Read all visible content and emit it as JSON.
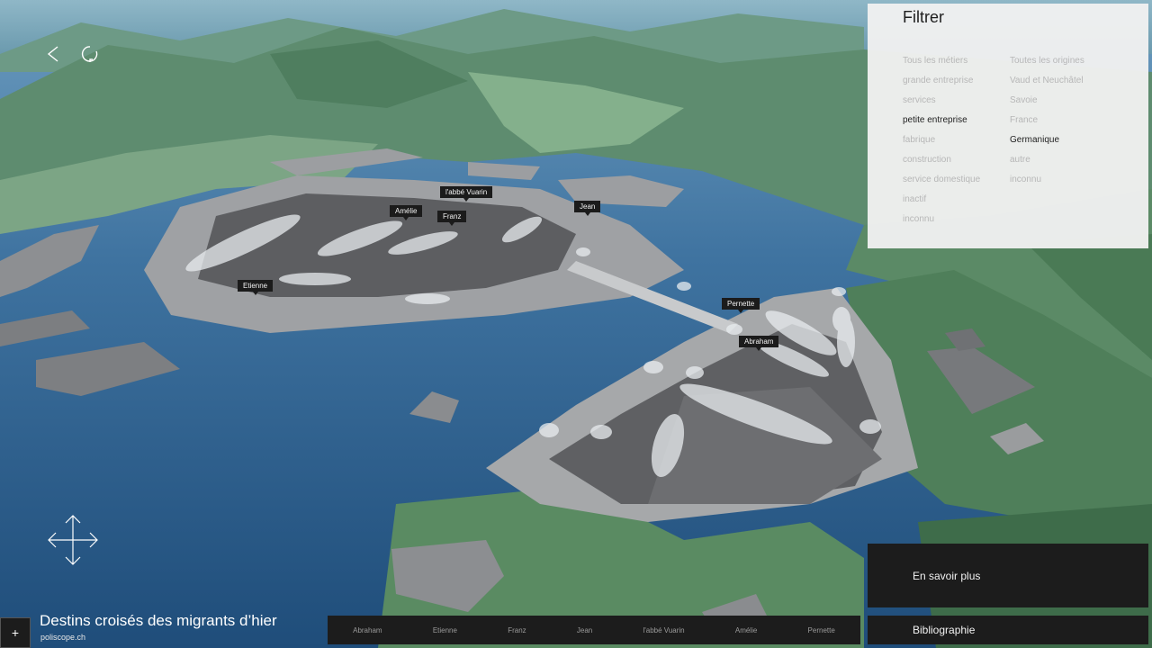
{
  "app": {
    "title": "Destins croisés des migrants d’hier",
    "site": "poliscope.ch",
    "plus_label": "+"
  },
  "controls": {
    "back_icon": "chevron-left-icon",
    "reload_icon": "rotate-icon",
    "pan_icon": "four-way-arrows-icon"
  },
  "map_pins": [
    {
      "label": "l'abbé Vuarin"
    },
    {
      "label": "Amélie"
    },
    {
      "label": "Franz"
    },
    {
      "label": "Jean"
    },
    {
      "label": "Etienne"
    },
    {
      "label": "Pernette"
    },
    {
      "label": "Abraham"
    }
  ],
  "filter": {
    "title": "Filtrer",
    "professions": [
      {
        "label": "Tous les métiers",
        "active": false
      },
      {
        "label": "grande entreprise",
        "active": false
      },
      {
        "label": "services",
        "active": false
      },
      {
        "label": "petite entreprise",
        "active": true
      },
      {
        "label": "fabrique",
        "active": false
      },
      {
        "label": "construction",
        "active": false
      },
      {
        "label": "service domestique",
        "active": false
      },
      {
        "label": "inactif",
        "active": false
      },
      {
        "label": "inconnu",
        "active": false
      }
    ],
    "origins": [
      {
        "label": "Toutes les origines",
        "active": false
      },
      {
        "label": "Vaud et Neuchâtel",
        "active": false
      },
      {
        "label": "Savoie",
        "active": false
      },
      {
        "label": "France",
        "active": false
      },
      {
        "label": "Germanique",
        "active": true
      },
      {
        "label": "autre",
        "active": false
      },
      {
        "label": "inconnu",
        "active": false
      }
    ]
  },
  "characters": [
    "Abraham",
    "Etienne",
    "Franz",
    "Jean",
    "l'abbé Vuarin",
    "Amélie",
    "Pernette"
  ],
  "buttons": {
    "learn_more": "En savoir plus",
    "bibliography": "Bibliographie"
  },
  "colors": {
    "lake": "#2c5677",
    "land": "#5f8a6a",
    "city": "#6b6b6d",
    "panel_dark": "#1c1c1c",
    "panel_light": "#f0f0f0"
  }
}
